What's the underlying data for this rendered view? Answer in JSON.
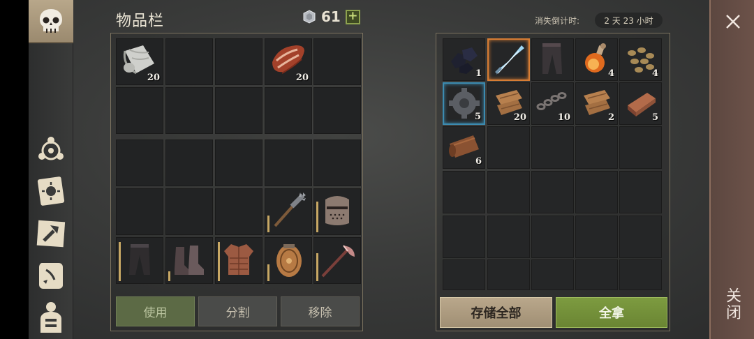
{
  "inventory": {
    "title": "物品栏",
    "currency_value": "61",
    "plus_label": "+",
    "slots": [
      {
        "icon": "cloth-roll-icon",
        "qty": "20"
      },
      {
        "icon": "empty",
        "qty": ""
      },
      {
        "icon": "empty",
        "qty": ""
      },
      {
        "icon": "raw-meat-icon",
        "qty": "20"
      },
      {
        "icon": "empty",
        "qty": ""
      }
    ],
    "buttons": {
      "use": "使用",
      "split": "分割",
      "remove": "移除"
    }
  },
  "container": {
    "timer_label": "消失倒计时:",
    "timer_value": "2 天 23 小时",
    "slots": [
      {
        "icon": "coal-icon",
        "qty": "1"
      },
      {
        "icon": "ice-sword-icon",
        "qty": ""
      },
      {
        "icon": "leather-pants-icon",
        "qty": ""
      },
      {
        "icon": "potion-icon",
        "qty": "4"
      },
      {
        "icon": "seeds-icon",
        "qty": "4"
      },
      {
        "icon": "gear-part-icon",
        "qty": "5"
      },
      {
        "icon": "fabric-scrap-icon",
        "qty": "20"
      },
      {
        "icon": "chain-icon",
        "qty": "10"
      },
      {
        "icon": "fabric-scrap-icon",
        "qty": "2"
      },
      {
        "icon": "copper-ingot-icon",
        "qty": "5"
      },
      {
        "icon": "leather-roll-icon",
        "qty": "6"
      }
    ],
    "buttons": {
      "store_all": "存储全部",
      "take_all": "全拿"
    }
  },
  "close": {
    "label": "关闭"
  },
  "colors": {
    "accent_green": "#7d9b40",
    "select_orange": "#d77d34",
    "select_blue": "#3c8bb0"
  }
}
